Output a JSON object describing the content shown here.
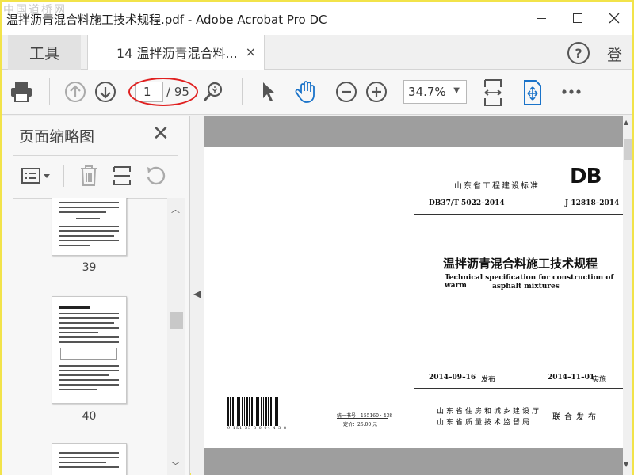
{
  "window": {
    "title": "温拌沥青混合料施工技术规程.pdf - Adobe Acrobat Pro DC",
    "watermark": "中国道桥网"
  },
  "tabs": {
    "tools_label": "工具",
    "doc_label": "14 温拌沥青混合料...",
    "close_glyph": "×",
    "login_label": "登录"
  },
  "toolbar": {
    "current_page": "1",
    "total_pages": "/ 95",
    "zoom": "34.7%"
  },
  "sidebar": {
    "title": "页面缩略图",
    "thumbnails": [
      {
        "page": "39"
      },
      {
        "page": "40"
      }
    ]
  },
  "document": {
    "issuer_top": "山东省工程建设标准",
    "db_mark": "DB",
    "standard_code": "DB37/T 5022–2014",
    "record_code": "J 12818–2014",
    "title_cn": "温拌沥青混合料施工技术规程",
    "title_en_line1": "Technical specification for construction of warm",
    "title_en_line2": "asphalt mixtures",
    "issue_date": "2014–09–16",
    "issue_label": "发布",
    "impl_date": "2014–11–01",
    "impl_label": "实施",
    "barcode_number": "9 151 33 3 0 04 4 3 8",
    "book_number": "统一书号：155160 · 438",
    "price": "定价：25.00 元",
    "publisher_line1": "山东省住房和城乡建设厅",
    "publisher_line2": "山东省质量技术监督局",
    "joint_label": "联合发布"
  }
}
